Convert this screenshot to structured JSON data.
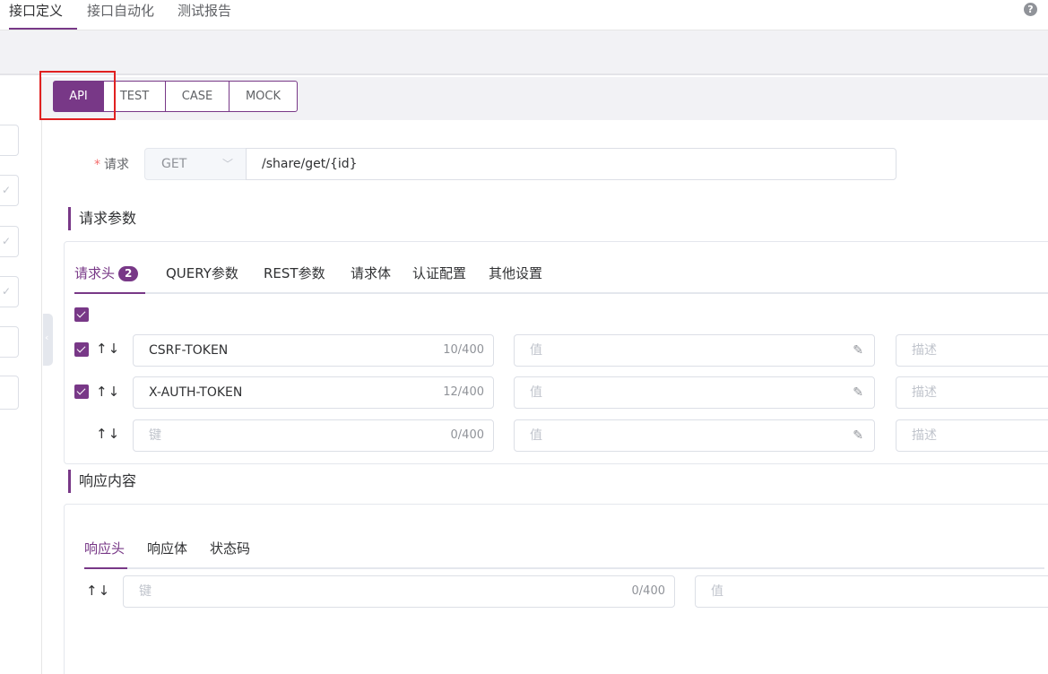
{
  "topnav": {
    "tabs": [
      "接口定义",
      "接口自动化",
      "测试报告"
    ],
    "help": "?"
  },
  "segment": {
    "items": [
      "API",
      "TEST",
      "CASE",
      "MOCK"
    ],
    "active": "API"
  },
  "request": {
    "label": "请求",
    "required_mark": "*",
    "method": "GET",
    "url": "/share/get/{id}"
  },
  "request_params": {
    "title": "请求参数",
    "tabs": [
      "请求头",
      "QUERY参数",
      "REST参数",
      "请求体",
      "认证配置",
      "其他设置"
    ],
    "header_count": "2",
    "rows": [
      {
        "key": "CSRF-TOKEN",
        "count": "10/400",
        "value_placeholder": "值",
        "desc_placeholder": "描述"
      },
      {
        "key": "X-AUTH-TOKEN",
        "count": "12/400",
        "value_placeholder": "值",
        "desc_placeholder": "描述"
      },
      {
        "key_placeholder": "键",
        "count": "0/400",
        "value_placeholder": "值",
        "desc_placeholder": "描述"
      }
    ]
  },
  "response": {
    "title": "响应内容",
    "tabs": [
      "响应头",
      "响应体",
      "状态码"
    ],
    "row": {
      "key_placeholder": "键",
      "count": "0/400",
      "value_placeholder": "值"
    }
  },
  "icons": {
    "arrows": "↑↓",
    "edit": "✎",
    "collapse": "‹",
    "check": "✓",
    "chevron": "﹀"
  },
  "colors": {
    "accent": "#783887",
    "highlight": "#e02020"
  }
}
